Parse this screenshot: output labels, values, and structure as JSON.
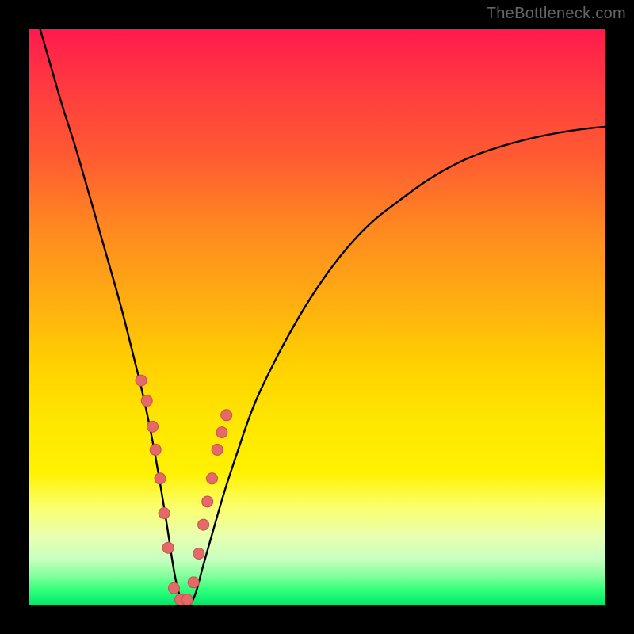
{
  "watermark": "TheBottleneck.com",
  "colors": {
    "background": "#000000",
    "curve_stroke": "#000000",
    "marker_fill": "#e46a6a",
    "marker_stroke": "#c94f4f"
  },
  "chart_data": {
    "type": "line",
    "title": "",
    "xlabel": "",
    "ylabel": "",
    "xlim": [
      0,
      100
    ],
    "ylim": [
      0,
      100
    ],
    "x": [
      0,
      2,
      4,
      6,
      8,
      10,
      12,
      14,
      16,
      18,
      20,
      22,
      24,
      25,
      26,
      27,
      28,
      29,
      30,
      32,
      34,
      36,
      38,
      40,
      44,
      48,
      52,
      56,
      60,
      64,
      68,
      72,
      76,
      80,
      84,
      88,
      92,
      96,
      100
    ],
    "values": [
      106,
      100,
      93,
      86,
      80,
      73,
      66,
      59,
      52,
      44,
      36,
      26,
      14,
      7,
      2,
      0,
      0,
      2,
      6,
      13,
      20,
      26,
      32,
      37,
      45,
      52,
      58,
      63,
      67,
      70,
      73,
      75.5,
      77.5,
      79,
      80.2,
      81.2,
      82,
      82.6,
      83
    ],
    "markers": {
      "x": [
        19.5,
        20.5,
        21.5,
        22,
        22.8,
        23.5,
        24.2,
        25.2,
        26.3,
        27.5,
        28.6,
        29.5,
        30.3,
        31,
        31.8,
        32.7,
        33.5,
        34.3
      ],
      "y": [
        39,
        35.5,
        31,
        27,
        22,
        16,
        10,
        3,
        1,
        1,
        4,
        9,
        14,
        18,
        22,
        27,
        30,
        33
      ]
    },
    "gradient_bands": [
      {
        "color": "#ff1a4d",
        "stop": 0
      },
      {
        "color": "#ff5a32",
        "stop": 22
      },
      {
        "color": "#ffb010",
        "stop": 48
      },
      {
        "color": "#ffe600",
        "stop": 68
      },
      {
        "color": "#fbff6e",
        "stop": 83
      },
      {
        "color": "#7fff9a",
        "stop": 95
      },
      {
        "color": "#00e56b",
        "stop": 100
      }
    ]
  }
}
